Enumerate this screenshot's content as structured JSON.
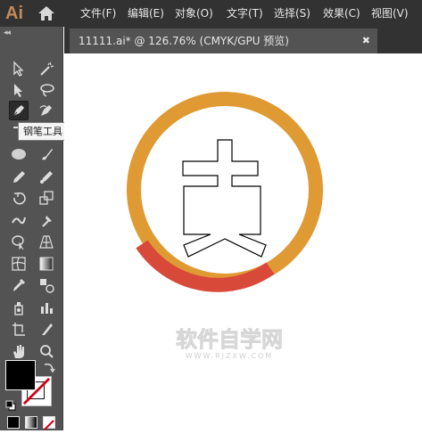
{
  "app": {
    "logo": "Ai"
  },
  "menu": [
    {
      "label": "文件(F)"
    },
    {
      "label": "编辑(E)"
    },
    {
      "label": "对象(O)"
    },
    {
      "label": "文字(T)"
    },
    {
      "label": "选择(S)"
    },
    {
      "label": "效果(C)"
    },
    {
      "label": "视图(V)"
    }
  ],
  "toolbar": {
    "collapse_glyph": "◂◂"
  },
  "tooltip": {
    "text": "钢笔工具 (P)"
  },
  "document_tab": {
    "title": "11111.ai* @ 126.76% (CMYK/GPU 预览)",
    "close_glyph": "✖"
  },
  "artwork": {
    "ring_color_main": "#e09a33",
    "ring_color_accent": "#d9493a",
    "watermark_main": "软件自学网",
    "watermark_sub": "WWW.RJZXW.COM"
  },
  "colors": {
    "fill": "#000000",
    "stroke": "none (white with red slash)"
  }
}
